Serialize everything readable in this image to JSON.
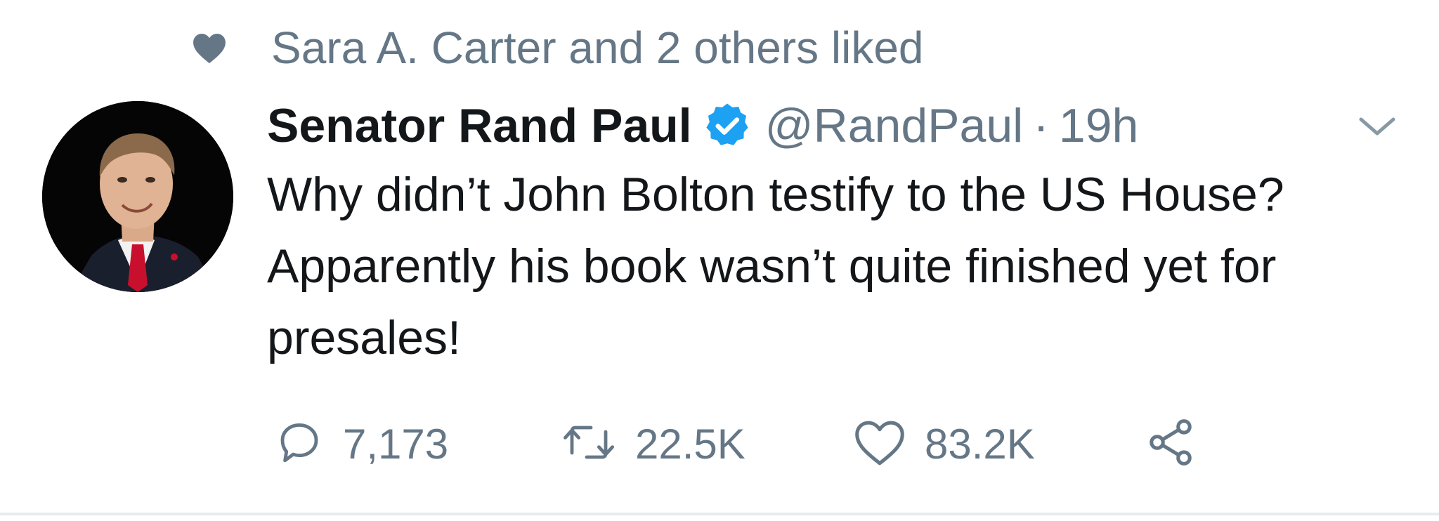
{
  "social_context": {
    "icon": "heart-filled-icon",
    "text": "Sara A. Carter and 2 others liked"
  },
  "author": {
    "display_name": "Senator Rand Paul",
    "verified_icon": "verified-badge-icon",
    "handle": "@RandPaul",
    "separator": "·",
    "time": "19h"
  },
  "menu": {
    "icon": "chevron-down-icon"
  },
  "tweet": {
    "text": "Why didn’t John Bolton testify to the US House? Apparently his book wasn’t quite finished yet for presales!"
  },
  "actions": {
    "reply": {
      "icon": "reply-icon",
      "count": "7,173"
    },
    "retweet": {
      "icon": "retweet-icon",
      "count": "22.5K"
    },
    "like": {
      "icon": "heart-outline-icon",
      "count": "83.2K"
    },
    "share": {
      "icon": "share-icon"
    }
  },
  "colors": {
    "text_primary": "#14171a",
    "text_secondary": "#657786",
    "verified_blue": "#1da1f2",
    "icon_gray": "#657786"
  }
}
